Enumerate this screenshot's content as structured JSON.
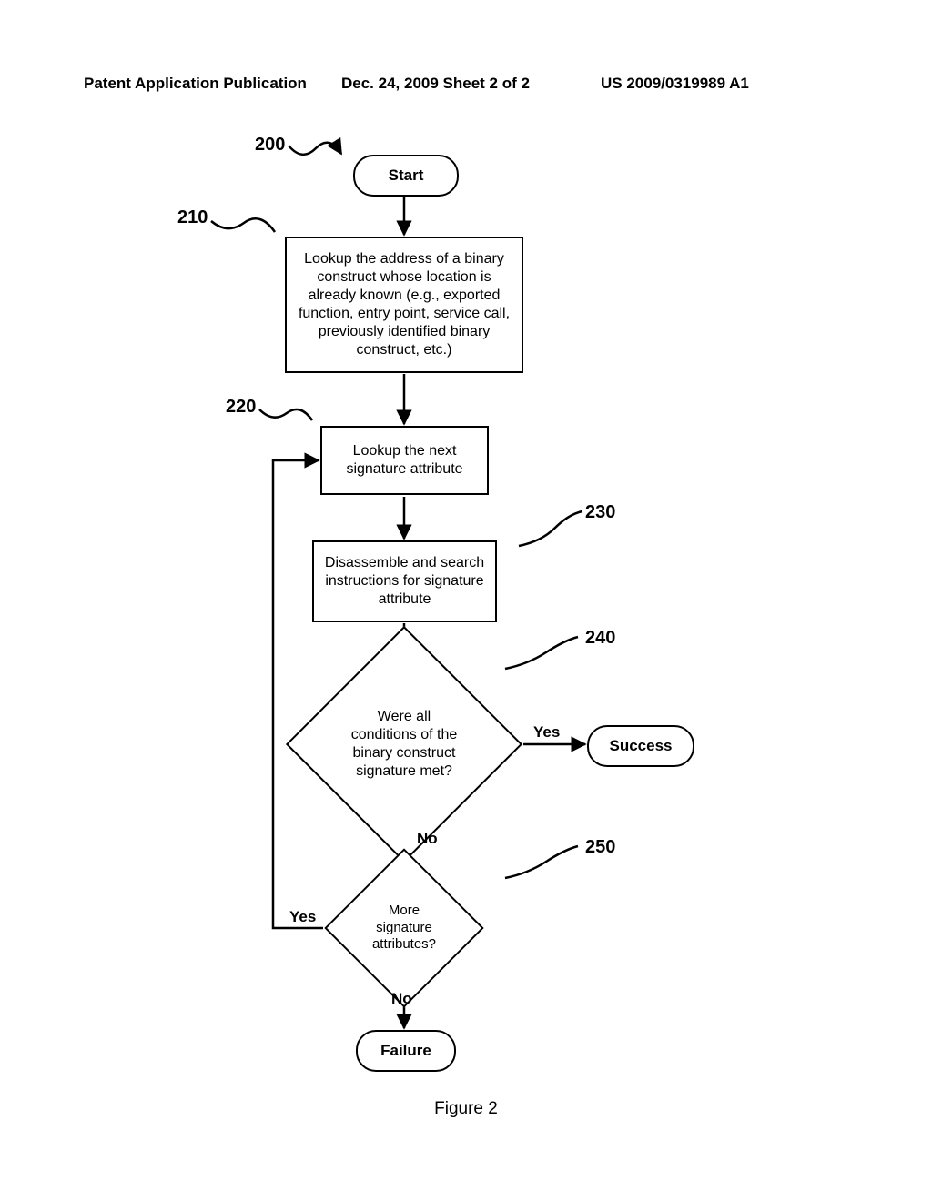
{
  "header": {
    "left": "Patent Application Publication",
    "middle": "Dec. 24, 2009  Sheet 2 of 2",
    "right": "US 2009/0319989 A1"
  },
  "refs": {
    "r200": "200",
    "r210": "210",
    "r220": "220",
    "r230": "230",
    "r240": "240",
    "r250": "250"
  },
  "nodes": {
    "start": "Start",
    "p210": "Lookup the address of a binary construct whose location is already known (e.g., exported function, entry point, service call, previously identified binary construct, etc.)",
    "p220": "Lookup the next signature attribute",
    "p230": "Disassemble and search instructions for signature attribute",
    "d240": "Were all conditions of the binary construct signature met?",
    "d250": "More signature attributes?",
    "success": "Success",
    "failure": "Failure"
  },
  "edges": {
    "yes": "Yes",
    "no": "No"
  },
  "caption": "Figure 2"
}
